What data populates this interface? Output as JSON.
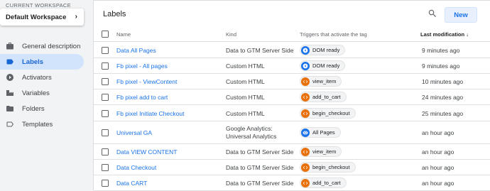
{
  "workspace": {
    "caption": "CURRENT WORKSPACE",
    "name": "Default Workspace"
  },
  "nav": [
    {
      "label": "General description",
      "icon": "briefcase-icon",
      "active": false
    },
    {
      "label": "Labels",
      "icon": "label-icon",
      "active": true
    },
    {
      "label": "Activators",
      "icon": "trigger-icon",
      "active": false
    },
    {
      "label": "Variables",
      "icon": "variables-icon",
      "active": false
    },
    {
      "label": "Folders",
      "icon": "folder-icon",
      "active": false
    },
    {
      "label": "Templates",
      "icon": "template-icon",
      "active": false
    }
  ],
  "panel": {
    "title": "Labels",
    "new_label": "New"
  },
  "columns": {
    "name": "Name",
    "kind": "Kind",
    "triggers": "Triggers that activate the tag",
    "modified": "Last modification"
  },
  "rows": [
    {
      "name": "Data All Pages",
      "kind": "Data to GTM Server Side",
      "trigger": "DOM ready",
      "trigger_type": "dom",
      "time": "9 minutes ago"
    },
    {
      "name": "Fb pixel - All pages",
      "kind": "Custom HTML",
      "trigger": "DOM ready",
      "trigger_type": "dom",
      "time": "9 minutes ago"
    },
    {
      "name": "Fb pixel - ViewContent",
      "kind": "Custom HTML",
      "trigger": "view_item",
      "trigger_type": "custom",
      "time": "10 minutes ago"
    },
    {
      "name": "Fb pixel add to cart",
      "kind": "Custom HTML",
      "trigger": "add_to_cart",
      "trigger_type": "custom",
      "time": "24 minutes ago"
    },
    {
      "name": "Fb pixel Initiate Checkout",
      "kind": "Custom HTML",
      "trigger": "begin_checkout",
      "trigger_type": "custom",
      "time": "25 minutes ago"
    },
    {
      "name": "Universal GA",
      "kind": "Google Analytics:",
      "kind2": "Universal Analytics",
      "trigger": "All Pages",
      "trigger_type": "all",
      "time": "an hour ago"
    },
    {
      "name": "Data VIEW CONTENT",
      "kind": "Data to GTM Server Side",
      "trigger": "view_item",
      "trigger_type": "custom",
      "time": "an hour ago"
    },
    {
      "name": "Data Checkout",
      "kind": "Data to GTM Server Side",
      "trigger": "begin_checkout",
      "trigger_type": "custom",
      "time": "an hour ago"
    },
    {
      "name": "Data CART",
      "kind": "Data to GTM Server Side",
      "trigger": "add_to_cart",
      "trigger_type": "custom",
      "time": "an hour ago"
    }
  ]
}
